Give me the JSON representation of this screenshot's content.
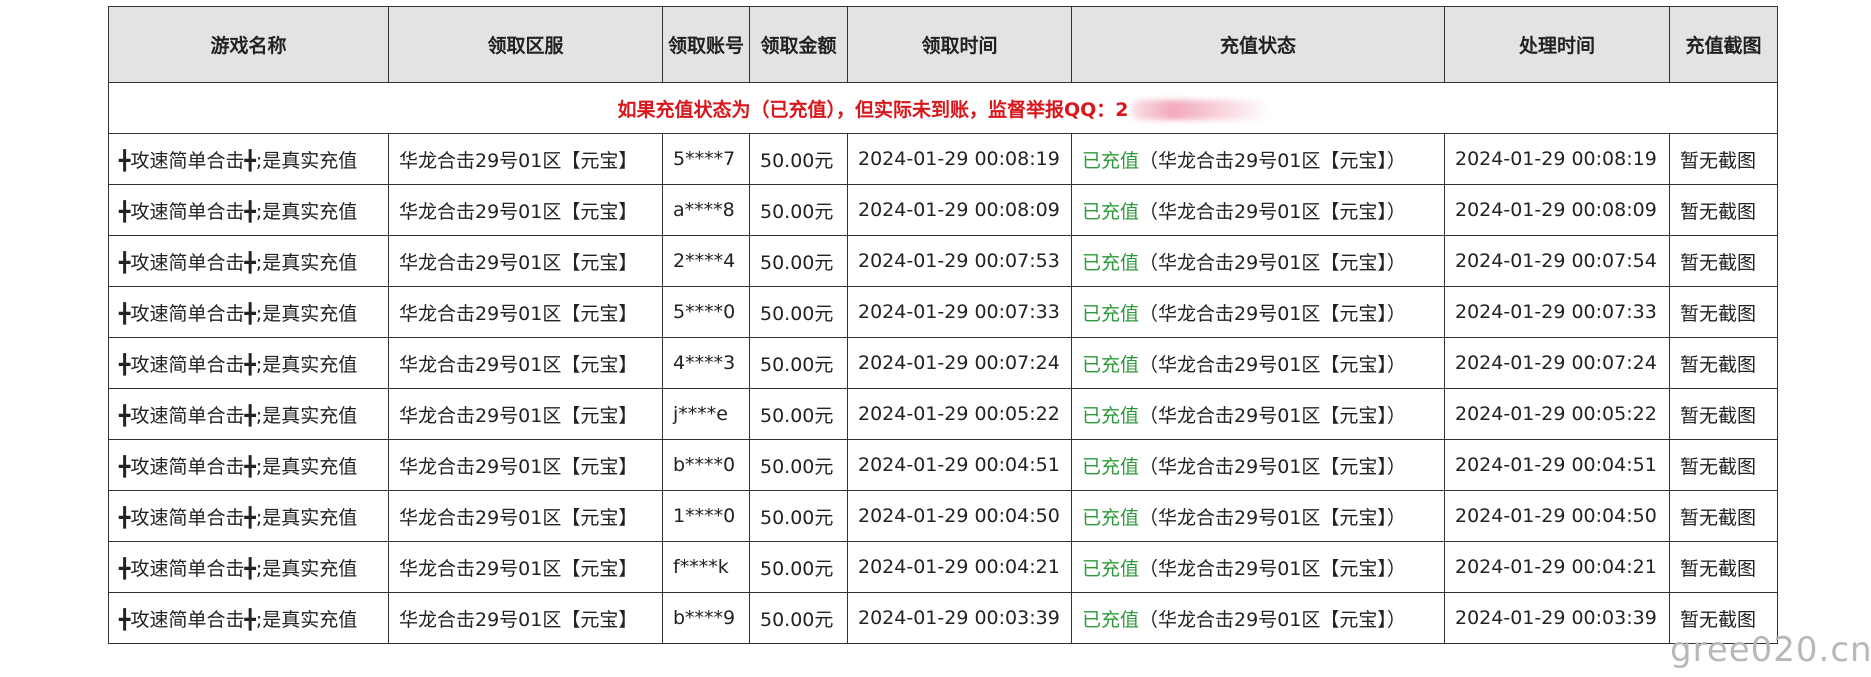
{
  "table": {
    "headers": [
      "游戏名称",
      "领取区服",
      "领取账号",
      "领取金额",
      "领取时间",
      "充值状态",
      "处理时间",
      "充值截图"
    ],
    "notice": "如果充值状态为（已充值），但实际未到账，监督举报QQ：",
    "notice_qq_visible": "2",
    "rows": [
      {
        "game": "╋攻速简单合击╋;是真实充值",
        "server": "华龙合击29号01区【元宝】",
        "account": "5****7",
        "amount": "50.00元",
        "claim_time": "2024-01-29 00:08:19",
        "status": "已充值",
        "status_detail": "（华龙合击29号01区【元宝】）",
        "process_time": "2024-01-29 00:08:19",
        "screenshot": "暂无截图"
      },
      {
        "game": "╋攻速简单合击╋;是真实充值",
        "server": "华龙合击29号01区【元宝】",
        "account": "a****8",
        "amount": "50.00元",
        "claim_time": "2024-01-29 00:08:09",
        "status": "已充值",
        "status_detail": "（华龙合击29号01区【元宝】）",
        "process_time": "2024-01-29 00:08:09",
        "screenshot": "暂无截图"
      },
      {
        "game": "╋攻速简单合击╋;是真实充值",
        "server": "华龙合击29号01区【元宝】",
        "account": "2****4",
        "amount": "50.00元",
        "claim_time": "2024-01-29 00:07:53",
        "status": "已充值",
        "status_detail": "（华龙合击29号01区【元宝】）",
        "process_time": "2024-01-29 00:07:54",
        "screenshot": "暂无截图"
      },
      {
        "game": "╋攻速简单合击╋;是真实充值",
        "server": "华龙合击29号01区【元宝】",
        "account": "5****0",
        "amount": "50.00元",
        "claim_time": "2024-01-29 00:07:33",
        "status": "已充值",
        "status_detail": "（华龙合击29号01区【元宝】）",
        "process_time": "2024-01-29 00:07:33",
        "screenshot": "暂无截图"
      },
      {
        "game": "╋攻速简单合击╋;是真实充值",
        "server": "华龙合击29号01区【元宝】",
        "account": "4****3",
        "amount": "50.00元",
        "claim_time": "2024-01-29 00:07:24",
        "status": "已充值",
        "status_detail": "（华龙合击29号01区【元宝】）",
        "process_time": "2024-01-29 00:07:24",
        "screenshot": "暂无截图"
      },
      {
        "game": "╋攻速简单合击╋;是真实充值",
        "server": "华龙合击29号01区【元宝】",
        "account": "j****e",
        "amount": "50.00元",
        "claim_time": "2024-01-29 00:05:22",
        "status": "已充值",
        "status_detail": "（华龙合击29号01区【元宝】）",
        "process_time": "2024-01-29 00:05:22",
        "screenshot": "暂无截图"
      },
      {
        "game": "╋攻速简单合击╋;是真实充值",
        "server": "华龙合击29号01区【元宝】",
        "account": "b****0",
        "amount": "50.00元",
        "claim_time": "2024-01-29 00:04:51",
        "status": "已充值",
        "status_detail": "（华龙合击29号01区【元宝】）",
        "process_time": "2024-01-29 00:04:51",
        "screenshot": "暂无截图"
      },
      {
        "game": "╋攻速简单合击╋;是真实充值",
        "server": "华龙合击29号01区【元宝】",
        "account": "1****0",
        "amount": "50.00元",
        "claim_time": "2024-01-29 00:04:50",
        "status": "已充值",
        "status_detail": "（华龙合击29号01区【元宝】）",
        "process_time": "2024-01-29 00:04:50",
        "screenshot": "暂无截图"
      },
      {
        "game": "╋攻速简单合击╋;是真实充值",
        "server": "华龙合击29号01区【元宝】",
        "account": "f****k",
        "amount": "50.00元",
        "claim_time": "2024-01-29 00:04:21",
        "status": "已充值",
        "status_detail": "（华龙合击29号01区【元宝】）",
        "process_time": "2024-01-29 00:04:21",
        "screenshot": "暂无截图"
      },
      {
        "game": "╋攻速简单合击╋;是真实充值",
        "server": "华龙合击29号01区【元宝】",
        "account": "b****9",
        "amount": "50.00元",
        "claim_time": "2024-01-29 00:03:39",
        "status": "已充值",
        "status_detail": "（华龙合击29号01区【元宝】）",
        "process_time": "2024-01-29 00:03:39",
        "screenshot": "暂无截图"
      }
    ]
  },
  "watermark": "gree020.cn",
  "colors": {
    "header_bg": "#e3e3e3",
    "notice_red": "#d8161b",
    "status_green": "#2d9a3a",
    "border": "#333333"
  }
}
